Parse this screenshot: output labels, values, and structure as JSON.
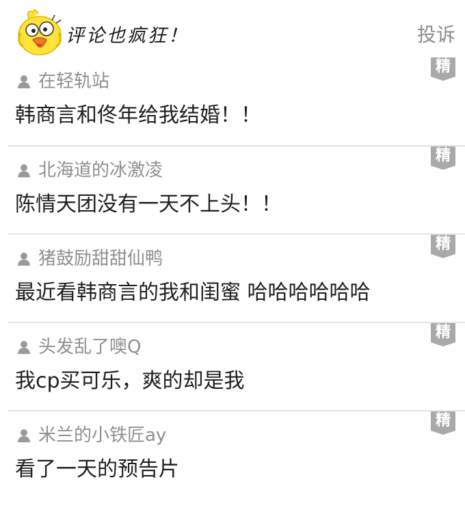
{
  "header": {
    "title": "评论也疯狂！",
    "report_label": "投诉",
    "mascot_icon": "yellow-chick-mascot"
  },
  "colors": {
    "badge": "#a9a9a9",
    "username": "#8f8f8f",
    "text": "#1f1f1f",
    "divider": "#e3e3e3"
  },
  "comments": [
    {
      "user": "在轻轨站",
      "text": "韩商言和佟年给我结婚！！",
      "badge": "精"
    },
    {
      "user": "北海道的冰激凌",
      "text": "陈情天团没有一天不上头！！",
      "badge": "精"
    },
    {
      "user": "猪鼓励甜甜仙鸭",
      "text": "最近看韩商言的我和闺蜜 哈哈哈哈哈哈",
      "badge": "精"
    },
    {
      "user": "头发乱了噢Q",
      "text": "我cp买可乐，爽的却是我",
      "badge": "精"
    },
    {
      "user": "米兰的小铁匠ay",
      "text": "看了一天的预告片",
      "badge": "精"
    }
  ]
}
